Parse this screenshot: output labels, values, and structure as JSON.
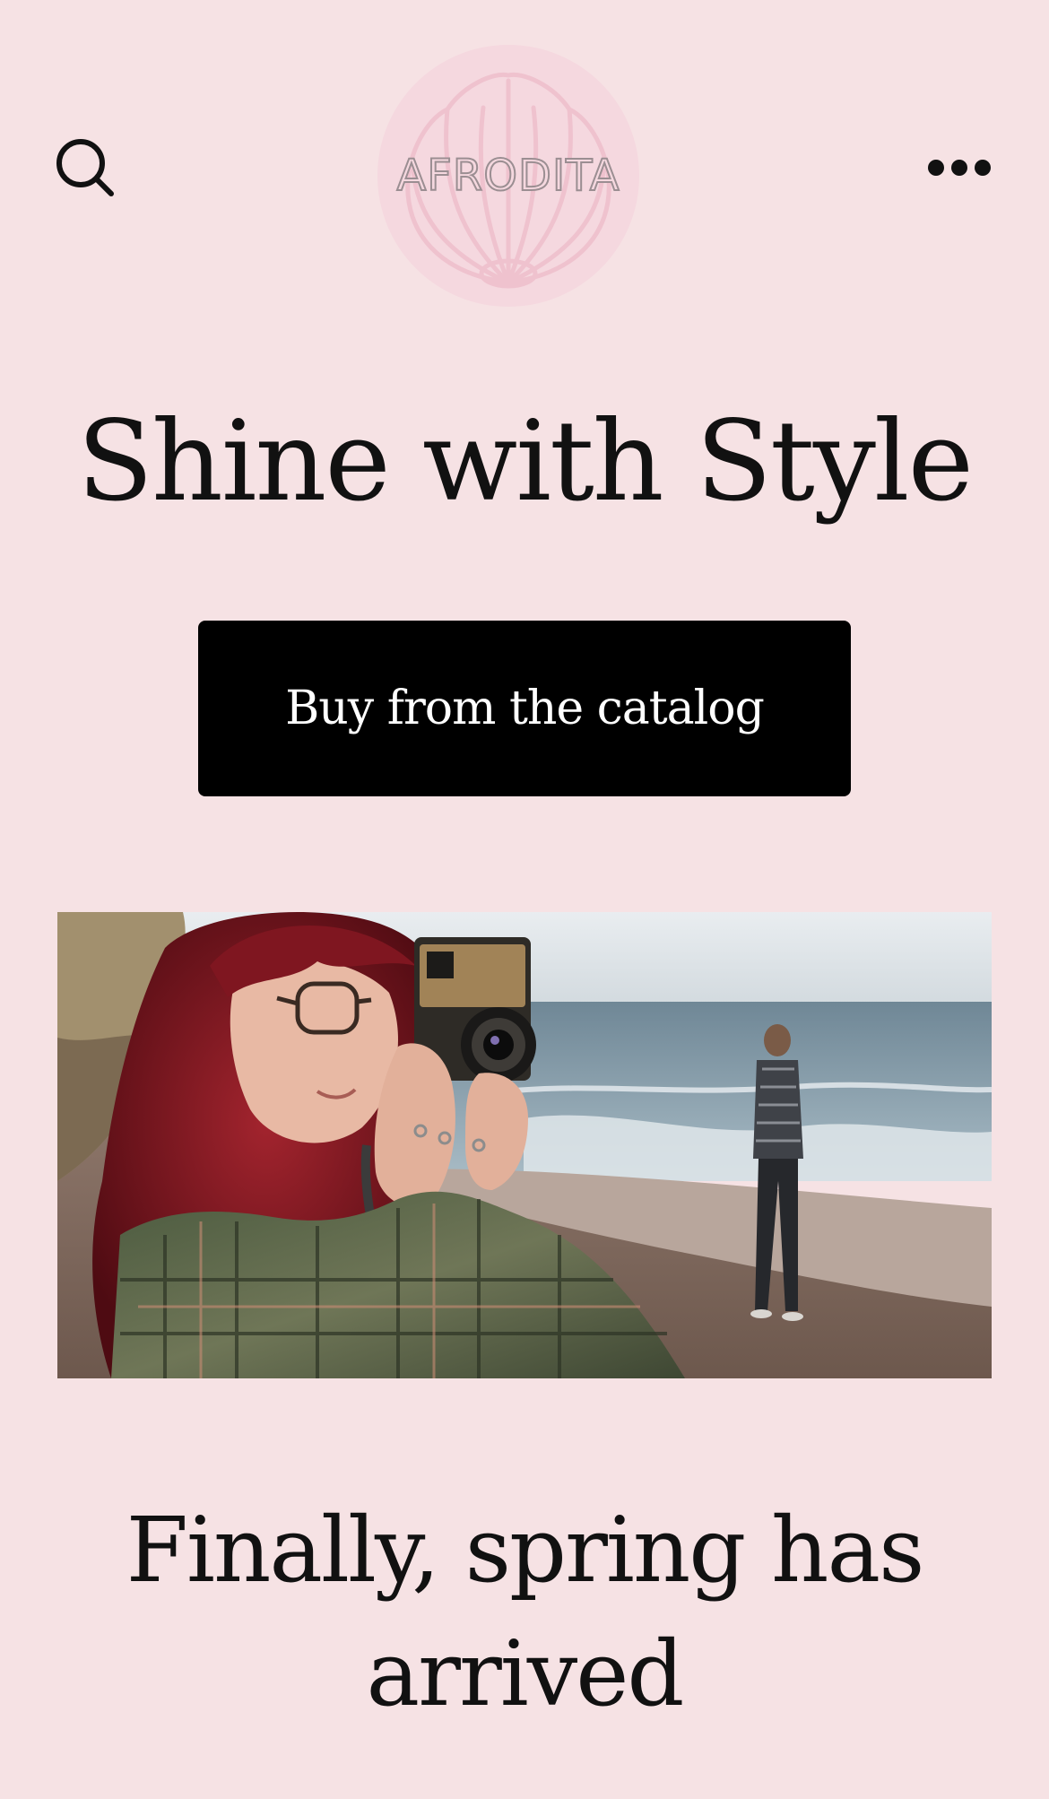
{
  "header": {
    "logo_text": "AFRODITA",
    "search_icon": "search-icon",
    "menu_icon": "more-horizontal-icon"
  },
  "hero": {
    "title": "Shine with Style",
    "cta_label": "Buy from the catalog"
  },
  "featured_image": {
    "subject": "woman-with-camera-on-beach"
  },
  "section": {
    "title": "Finally, spring has arrived"
  },
  "colors": {
    "background": "#f6e2e4",
    "logo_circle": "#f5d8df",
    "logo_shell": "#efc2ce",
    "button": "#000000",
    "button_text": "#ffffff",
    "text": "#111111"
  }
}
